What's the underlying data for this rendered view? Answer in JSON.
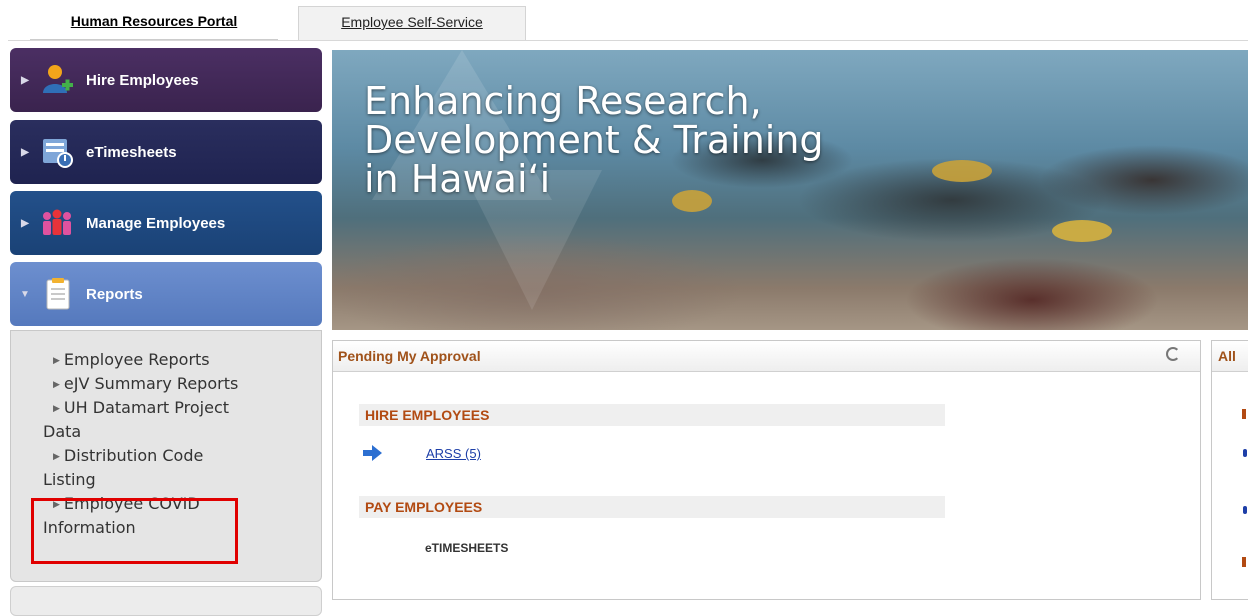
{
  "tabs": {
    "active": "Human Resources Portal",
    "inactive": "Employee Self-Service"
  },
  "sidebar": {
    "items": [
      {
        "label": "Hire Employees",
        "icon": "person-add-icon"
      },
      {
        "label": "eTimesheets",
        "icon": "timesheet-clock-icon"
      },
      {
        "label": "Manage Employees",
        "icon": "people-group-icon"
      },
      {
        "label": "Reports",
        "icon": "document-icon"
      }
    ],
    "reports_submenu": {
      "employee_reports": "Employee Reports",
      "ejv_summary": "eJV Summary Reports",
      "uh_datamart_1": "UH Datamart Project",
      "uh_datamart_2": "Data",
      "distribution_1": "Distribution Code",
      "distribution_2": "Listing",
      "covid_1": "Employee COVID",
      "covid_2": "Information"
    }
  },
  "banner": {
    "line1": "Enhancing Research,",
    "line2": "Development & Training",
    "line3": "in Hawai‘i"
  },
  "pending": {
    "title": "Pending My Approval",
    "hire_section": "HIRE EMPLOYEES",
    "hire_link": "ARSS (5)",
    "pay_section": "PAY EMPLOYEES",
    "pay_item": "eTIMESHEETS"
  },
  "right_panel": {
    "title": "All"
  },
  "colors": {
    "hire_bg": "#3f2857",
    "etimesheets_bg": "#23284f",
    "manage_bg": "#1e4a80",
    "reports_bg": "#5f84c6",
    "section_text": "#b24a12",
    "link": "#1d3fa8",
    "highlight": "#e00000"
  }
}
